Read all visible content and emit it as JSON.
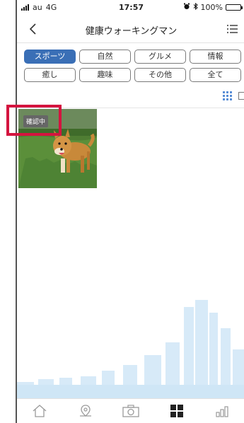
{
  "status_bar": {
    "carrier": "au",
    "network": "4G",
    "time": "17:57",
    "battery": "100%"
  },
  "nav": {
    "title": "健康ウォーキングマン"
  },
  "categories": {
    "row1": [
      "スポーツ",
      "自然",
      "グルメ",
      "情報"
    ],
    "row2": [
      "癒し",
      "趣味",
      "その他",
      "全て"
    ],
    "selected": "スポーツ"
  },
  "gallery": {
    "items": [
      {
        "badge": "確認中"
      }
    ]
  },
  "colors": {
    "accent": "#3a6fb6",
    "highlight": "#d4143f",
    "battery": "#4cd964",
    "skyline": "#cfe6f6"
  },
  "tabbar": {
    "icons": [
      "home-icon",
      "map-pin-icon",
      "camera-icon",
      "grid-icon",
      "bar-chart-icon"
    ],
    "active": "grid-icon"
  }
}
